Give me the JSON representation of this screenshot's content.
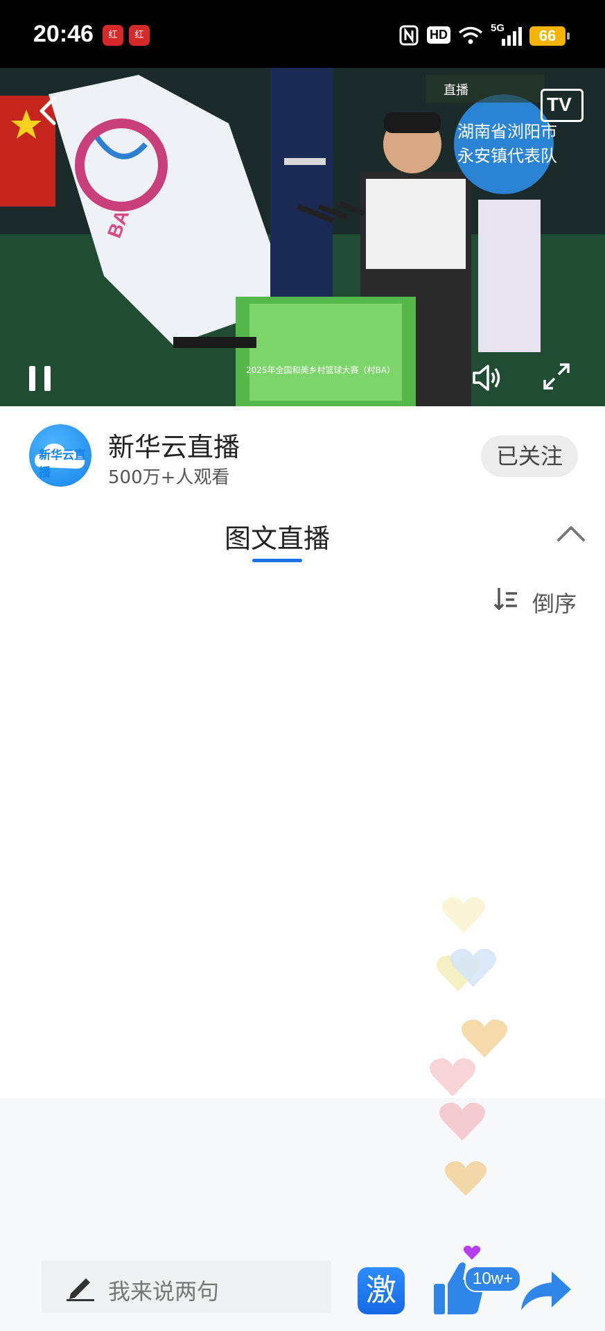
{
  "status_bar": {
    "time": "20:46",
    "badges": [
      "红",
      "红"
    ],
    "network": "5G",
    "hd": "HD",
    "battery": "66"
  },
  "video": {
    "overlay_tag": "直播",
    "controls": {
      "back_icon": "chevron-left-icon",
      "tv_label": "TV",
      "pause_icon": "pause-icon",
      "volume_icon": "speaker-icon",
      "fullscreen_icon": "expand-icon"
    },
    "scene_banner": "2025年全国和美乡村篮球大赛（村BA）",
    "scene_sign": "湖南省浏阳市 永安镇代表队",
    "flag_letters": "BA"
  },
  "channel": {
    "logo_text": "新华云直播",
    "name": "新华云直播",
    "viewers": "500万+人观看",
    "follow_label": "已关注"
  },
  "tabs": {
    "active": "图文直播"
  },
  "sort": {
    "label": "倒序"
  },
  "bottom_bar": {
    "comment_placeholder": "我来说两句",
    "ji_label": "激",
    "like_count": "10w+"
  },
  "colors": {
    "accent": "#1a73e8",
    "follow_bg": "#ececec"
  }
}
